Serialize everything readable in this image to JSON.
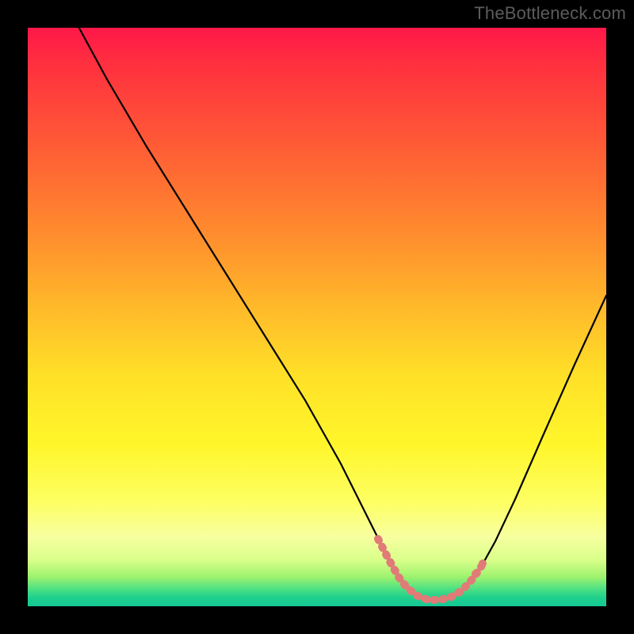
{
  "watermark": "TheBottleneck.com",
  "colors": {
    "background": "#000000",
    "curve": "#000000",
    "highlight": "#e07b78",
    "watermark": "#5c5c5c"
  },
  "chart_data": {
    "type": "line",
    "title": "",
    "xlabel": "",
    "ylabel": "",
    "xlim": [
      0,
      100
    ],
    "ylim": [
      0,
      100
    ],
    "grid": false,
    "series": [
      {
        "name": "curve",
        "x": [
          10,
          15,
          20,
          25,
          30,
          35,
          40,
          45,
          50,
          55,
          57,
          60,
          63,
          65,
          68,
          70,
          72,
          75,
          78,
          80,
          85,
          90,
          95,
          100
        ],
        "y": [
          100,
          91,
          82,
          73,
          64,
          55,
          46,
          37,
          28,
          18,
          13,
          8,
          4,
          2,
          1,
          1,
          1,
          2,
          5,
          9,
          19,
          30,
          41,
          52
        ]
      }
    ],
    "highlight_range_x": [
      57,
      78
    ],
    "annotations": []
  }
}
